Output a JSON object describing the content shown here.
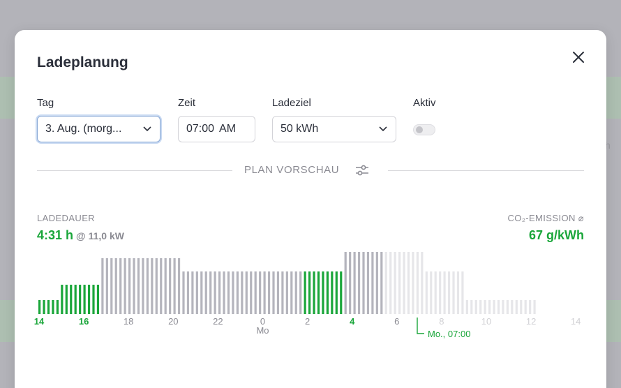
{
  "modal": {
    "title": "Ladeplanung"
  },
  "fields": {
    "day_label": "Tag",
    "day_value": "3. Aug. (morg...",
    "time_label": "Zeit",
    "time_value": "07:00",
    "time_period": "AM",
    "target_label": "Ladeziel",
    "target_value": "50 kWh",
    "active_label": "Aktiv",
    "active_value": false
  },
  "plan": {
    "section_title": "PLAN VORSCHAU",
    "duration_label": "LADEDAUER",
    "duration_value": "4:31 h",
    "power_value": "@ 11,0 kW",
    "co2_label": "CO₂-EMISSION ⌀",
    "co2_value": "67 g/kWh"
  },
  "backdrop": {
    "partial_text": "ch"
  },
  "colors": {
    "charging": "#1aa63a",
    "past": "#b4b4bc",
    "future": "#e6e6e9",
    "text": "#2b2f3a",
    "muted": "#8a8a92"
  },
  "chart_data": {
    "type": "bar",
    "x_ticks": [
      "14",
      "16",
      "18",
      "20",
      "22",
      "0",
      "2",
      "4",
      "6",
      "8",
      "10",
      "12",
      "14"
    ],
    "x_sublabel": "Mo",
    "deadline_label": "Mo., 07:00",
    "bars": [
      {
        "h": 1,
        "s": "c"
      },
      {
        "h": 1,
        "s": "c"
      },
      {
        "h": 1,
        "s": "c"
      },
      {
        "h": 1,
        "s": "c"
      },
      {
        "h": 1,
        "s": "c"
      },
      {
        "h": 2,
        "s": "c"
      },
      {
        "h": 2,
        "s": "c"
      },
      {
        "h": 2,
        "s": "c"
      },
      {
        "h": 2,
        "s": "c"
      },
      {
        "h": 2,
        "s": "c"
      },
      {
        "h": 2,
        "s": "c"
      },
      {
        "h": 2,
        "s": "c"
      },
      {
        "h": 2,
        "s": "c"
      },
      {
        "h": 2,
        "s": "c"
      },
      {
        "h": 4,
        "s": "p"
      },
      {
        "h": 4,
        "s": "p"
      },
      {
        "h": 4,
        "s": "p"
      },
      {
        "h": 4,
        "s": "p"
      },
      {
        "h": 4,
        "s": "p"
      },
      {
        "h": 4,
        "s": "p"
      },
      {
        "h": 4,
        "s": "p"
      },
      {
        "h": 4,
        "s": "p"
      },
      {
        "h": 4,
        "s": "p"
      },
      {
        "h": 4,
        "s": "p"
      },
      {
        "h": 4,
        "s": "p"
      },
      {
        "h": 4,
        "s": "p"
      },
      {
        "h": 4,
        "s": "p"
      },
      {
        "h": 4,
        "s": "p"
      },
      {
        "h": 4,
        "s": "p"
      },
      {
        "h": 4,
        "s": "p"
      },
      {
        "h": 4,
        "s": "p"
      },
      {
        "h": 4,
        "s": "p"
      },
      {
        "h": 3,
        "s": "p"
      },
      {
        "h": 3,
        "s": "p"
      },
      {
        "h": 3,
        "s": "p"
      },
      {
        "h": 3,
        "s": "p"
      },
      {
        "h": 3,
        "s": "p"
      },
      {
        "h": 3,
        "s": "p"
      },
      {
        "h": 3,
        "s": "p"
      },
      {
        "h": 3,
        "s": "p"
      },
      {
        "h": 3,
        "s": "p"
      },
      {
        "h": 3,
        "s": "p"
      },
      {
        "h": 3,
        "s": "p"
      },
      {
        "h": 3,
        "s": "p"
      },
      {
        "h": 3,
        "s": "p"
      },
      {
        "h": 3,
        "s": "p"
      },
      {
        "h": 3,
        "s": "p"
      },
      {
        "h": 3,
        "s": "p"
      },
      {
        "h": 3,
        "s": "p"
      },
      {
        "h": 3,
        "s": "p"
      },
      {
        "h": 3,
        "s": "p"
      },
      {
        "h": 3,
        "s": "p"
      },
      {
        "h": 3,
        "s": "p"
      },
      {
        "h": 3,
        "s": "p"
      },
      {
        "h": 3,
        "s": "p"
      },
      {
        "h": 3,
        "s": "p"
      },
      {
        "h": 3,
        "s": "p"
      },
      {
        "h": 3,
        "s": "p"
      },
      {
        "h": 3,
        "s": "p"
      },
      {
        "h": 3,
        "s": "c"
      },
      {
        "h": 3,
        "s": "c"
      },
      {
        "h": 3,
        "s": "c"
      },
      {
        "h": 3,
        "s": "c"
      },
      {
        "h": 3,
        "s": "c"
      },
      {
        "h": 3,
        "s": "c"
      },
      {
        "h": 3,
        "s": "c"
      },
      {
        "h": 3,
        "s": "c"
      },
      {
        "h": 3,
        "s": "c"
      },
      {
        "h": 5,
        "s": "p"
      },
      {
        "h": 5,
        "s": "p"
      },
      {
        "h": 5,
        "s": "p"
      },
      {
        "h": 5,
        "s": "p"
      },
      {
        "h": 5,
        "s": "p"
      },
      {
        "h": 5,
        "s": "p"
      },
      {
        "h": 5,
        "s": "p"
      },
      {
        "h": 5,
        "s": "p"
      },
      {
        "h": 5,
        "s": "p"
      },
      {
        "h": 5,
        "s": "f"
      },
      {
        "h": 5,
        "s": "f"
      },
      {
        "h": 5,
        "s": "f"
      },
      {
        "h": 5,
        "s": "f"
      },
      {
        "h": 5,
        "s": "f"
      },
      {
        "h": 5,
        "s": "f"
      },
      {
        "h": 5,
        "s": "f"
      },
      {
        "h": 5,
        "s": "f"
      },
      {
        "h": 5,
        "s": "f"
      },
      {
        "h": 3,
        "s": "f"
      },
      {
        "h": 3,
        "s": "f"
      },
      {
        "h": 3,
        "s": "f"
      },
      {
        "h": 3,
        "s": "f"
      },
      {
        "h": 3,
        "s": "f"
      },
      {
        "h": 3,
        "s": "f"
      },
      {
        "h": 3,
        "s": "f"
      },
      {
        "h": 3,
        "s": "f"
      },
      {
        "h": 3,
        "s": "f"
      },
      {
        "h": 1,
        "s": "f"
      },
      {
        "h": 1,
        "s": "f"
      },
      {
        "h": 1,
        "s": "f"
      },
      {
        "h": 1,
        "s": "f"
      },
      {
        "h": 1,
        "s": "f"
      },
      {
        "h": 1,
        "s": "f"
      },
      {
        "h": 1,
        "s": "f"
      },
      {
        "h": 1,
        "s": "f"
      },
      {
        "h": 1,
        "s": "f"
      },
      {
        "h": 1,
        "s": "f"
      },
      {
        "h": 1,
        "s": "f"
      },
      {
        "h": 1,
        "s": "f"
      },
      {
        "h": 1,
        "s": "f"
      },
      {
        "h": 1,
        "s": "f"
      },
      {
        "h": 1,
        "s": "f"
      },
      {
        "h": 1,
        "s": "f"
      }
    ],
    "level_scale": [
      1,
      2,
      3,
      4,
      5
    ],
    "series_legend": {
      "c": "charging",
      "p": "past",
      "f": "future"
    }
  }
}
